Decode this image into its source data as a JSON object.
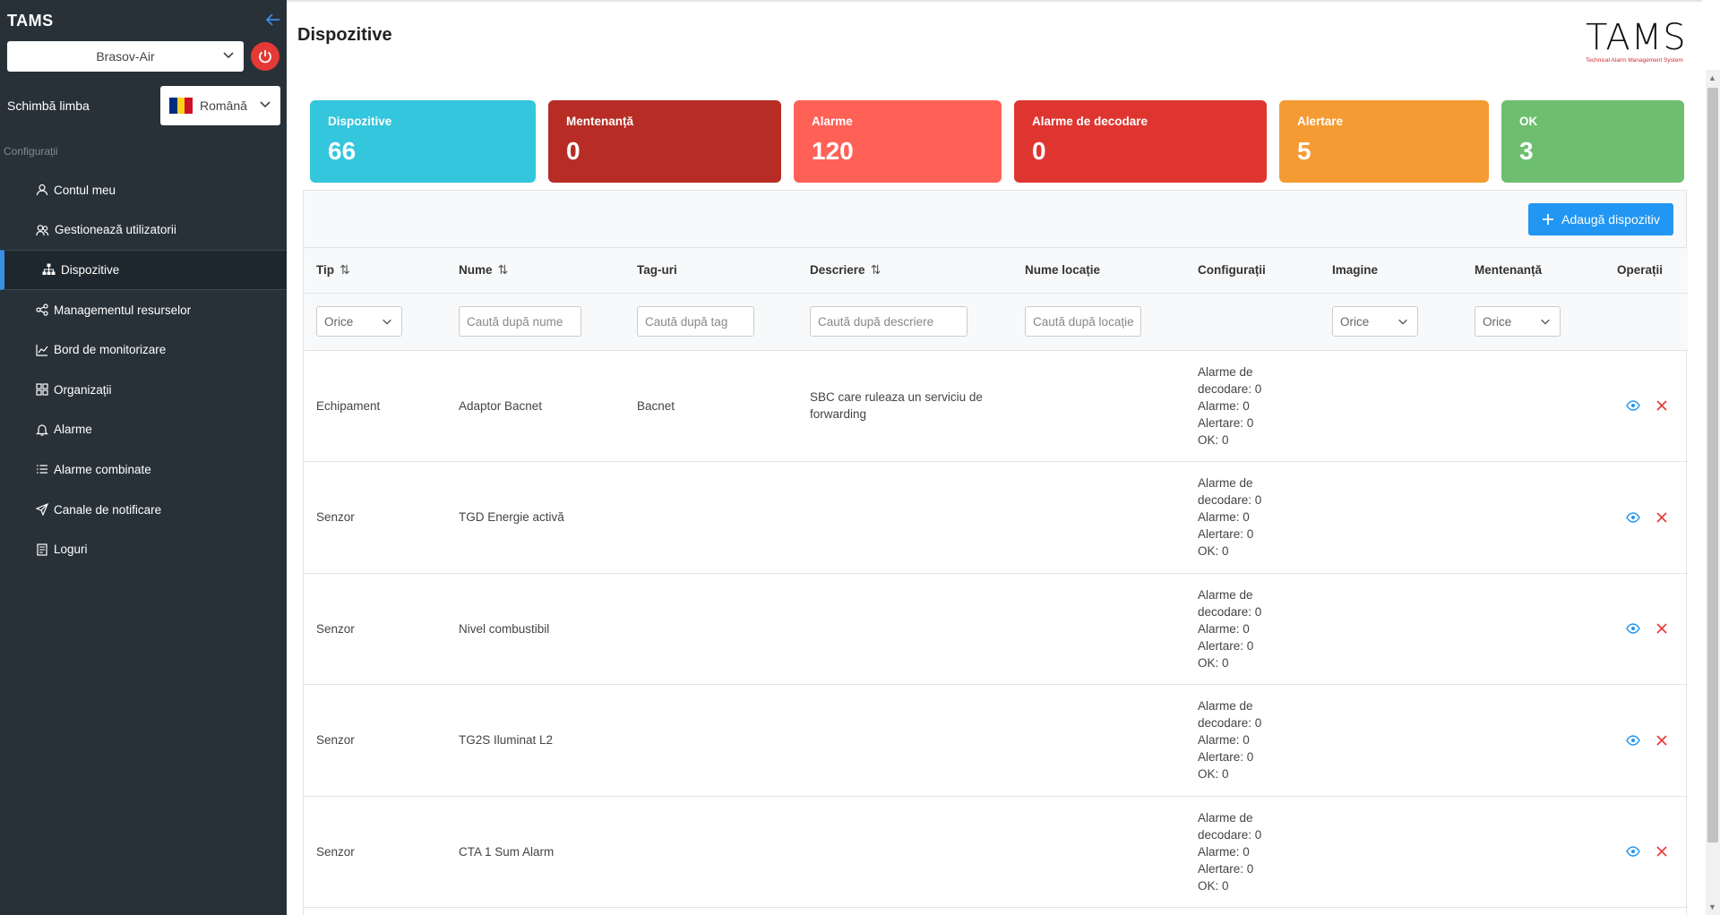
{
  "app": {
    "title": "TAMS"
  },
  "sidebar": {
    "org_select": "Brasov-Air",
    "language_label": "Schimbă limba",
    "language_value": "Română",
    "section_label": "Configurații",
    "items": [
      {
        "label": "Contul meu",
        "icon": "user-icon"
      },
      {
        "label": "Gestionează utilizatorii",
        "icon": "users-icon"
      },
      {
        "label": "Dispozitive",
        "icon": "sitemap-icon",
        "active": true
      },
      {
        "label": "Managementul resurselor",
        "icon": "share-icon"
      },
      {
        "label": "Bord de monitorizare",
        "icon": "chart-line-icon"
      },
      {
        "label": "Organizații",
        "icon": "grid-icon"
      },
      {
        "label": "Alarme",
        "icon": "bell-icon"
      },
      {
        "label": "Alarme combinate",
        "icon": "list-icon"
      },
      {
        "label": "Canale de notificare",
        "icon": "send-icon"
      },
      {
        "label": "Loguri",
        "icon": "book-icon"
      }
    ]
  },
  "header": {
    "page_title": "Dispozitive",
    "logo_text": "TAMS",
    "logo_subtitle": "Technical Alarm Management System"
  },
  "cards": [
    {
      "label": "Dispozitive",
      "value": "66",
      "color": "#33c6dd"
    },
    {
      "label": "Mentenanță",
      "value": "0",
      "color": "#b72d25"
    },
    {
      "label": "Alarme",
      "value": "120",
      "color": "#ff6157"
    },
    {
      "label": "Alarme de decodare",
      "value": "0",
      "color": "#df3530"
    },
    {
      "label": "Alertare",
      "value": "5",
      "color": "#f59b33"
    },
    {
      "label": "OK",
      "value": "3",
      "color": "#6dbf6f"
    }
  ],
  "toolbar": {
    "add_label": "Adaugă dispozitiv"
  },
  "table": {
    "columns": [
      "Tip",
      "Nume",
      "Tag-uri",
      "Descriere",
      "Nume locație",
      "Configurații",
      "Imagine",
      "Mentenanță",
      "Operații"
    ],
    "filters": {
      "tip": "Orice",
      "nume_placeholder": "Caută după nume",
      "tag_placeholder": "Caută după tag",
      "descriere_placeholder": "Caută după descriere",
      "locatie_placeholder": "Caută după locație",
      "imagine": "Orice",
      "mentenanta": "Orice"
    },
    "rows": [
      {
        "tip": "Echipament",
        "nume": "Adaptor Bacnet",
        "tag": "Bacnet",
        "descriere": "SBC care ruleaza un serviciu de forwarding",
        "locatie": "",
        "cfg": [
          "Alarme de",
          "decodare: 0",
          "Alarme: 0",
          "Alertare: 0",
          "OK: 0"
        ]
      },
      {
        "tip": "Senzor",
        "nume": "TGD Energie activă",
        "tag": "",
        "descriere": "",
        "locatie": "",
        "cfg": [
          "Alarme de",
          "decodare: 0",
          "Alarme: 0",
          "Alertare: 0",
          "OK: 0"
        ]
      },
      {
        "tip": "Senzor",
        "nume": "Nivel combustibil",
        "tag": "",
        "descriere": "",
        "locatie": "",
        "cfg": [
          "Alarme de",
          "decodare: 0",
          "Alarme: 0",
          "Alertare: 0",
          "OK: 0"
        ]
      },
      {
        "tip": "Senzor",
        "nume": "TG2S Iluminat L2",
        "tag": "",
        "descriere": "",
        "locatie": "",
        "cfg": [
          "Alarme de",
          "decodare: 0",
          "Alarme: 0",
          "Alertare: 0",
          "OK: 0"
        ]
      },
      {
        "tip": "Senzor",
        "nume": "CTA 1 Sum Alarm",
        "tag": "",
        "descriere": "",
        "locatie": "",
        "cfg": [
          "Alarme de",
          "decodare: 0",
          "Alarme: 0",
          "Alertare: 0",
          "OK: 0"
        ]
      }
    ]
  },
  "colors": {
    "sidebar_bg": "#283138",
    "accent": "#2196f3",
    "danger": "#e53935"
  }
}
